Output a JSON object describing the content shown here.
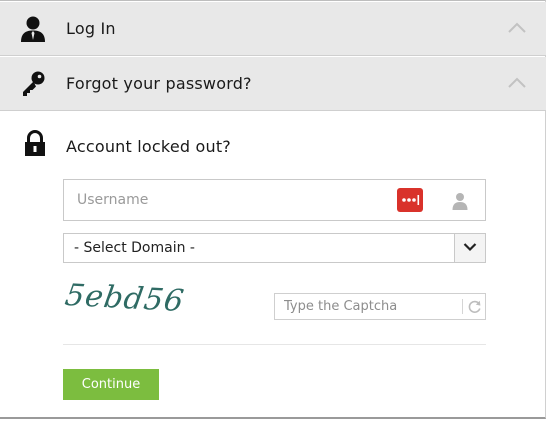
{
  "accordion": {
    "login": {
      "title": "Log In",
      "icon": "user-icon"
    },
    "forgot": {
      "title": "Forgot your password?",
      "icon": "key-icon"
    },
    "locked": {
      "title": "Account locked out?",
      "icon": "lock-icon"
    }
  },
  "form": {
    "username": {
      "placeholder": "Username",
      "value": ""
    },
    "domain": {
      "selected": "- Select Domain -"
    },
    "captcha": {
      "image_text": "5ebd56",
      "placeholder": "Type the Captcha",
      "value": ""
    },
    "continue_label": "Continue"
  },
  "colors": {
    "header_bg": "#e8e8e8",
    "continue_green": "#7cbd3f",
    "password_badge_red": "#d9322b",
    "captcha_text": "#2f6b64"
  }
}
